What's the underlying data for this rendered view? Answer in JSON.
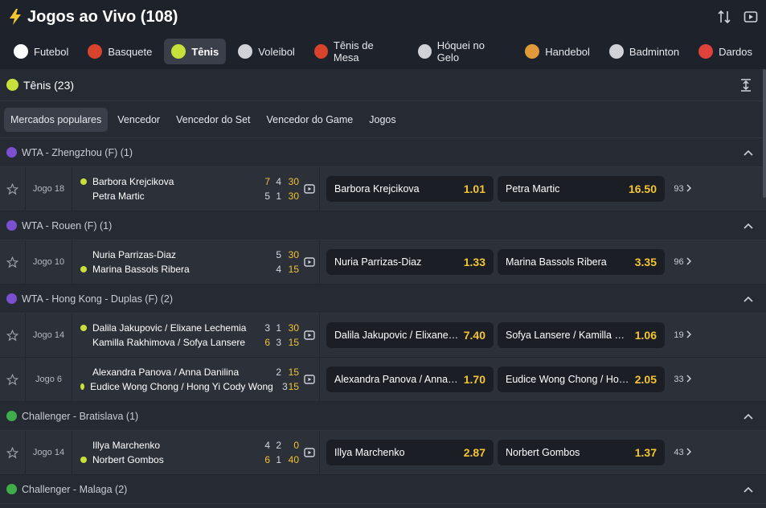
{
  "header": {
    "title": "Jogos ao Vivo (108)"
  },
  "sports": [
    {
      "label": "Futebol",
      "icon": "soccer-ball-icon",
      "color": "#ffffff"
    },
    {
      "label": "Basquete",
      "icon": "basketball-icon",
      "color": "#d8432e"
    },
    {
      "label": "Tênis",
      "icon": "tennis-ball-icon",
      "color": "#c8e03a",
      "active": true
    },
    {
      "label": "Voleibol",
      "icon": "volleyball-icon",
      "color": "#cfd2d8"
    },
    {
      "label": "Tênis de Mesa",
      "icon": "table-tennis-icon",
      "color": "#d8432e"
    },
    {
      "label": "Hóquei no Gelo",
      "icon": "hockey-stick-icon",
      "color": "#cfd2d8"
    },
    {
      "label": "Handebol",
      "icon": "handball-icon",
      "color": "#e09a3a"
    },
    {
      "label": "Badminton",
      "icon": "shuttlecock-icon",
      "color": "#cfd2d8"
    },
    {
      "label": "Dardos",
      "icon": "dart-icon",
      "color": "#e0413a"
    }
  ],
  "section": {
    "title": "Tênis (23)"
  },
  "tabs": [
    "Mercados populares",
    "Vencedor",
    "Vencedor do Set",
    "Vencedor do Game",
    "Jogos"
  ],
  "leagues": [
    {
      "name": "WTA - Zhengzhou (F) (1)",
      "badge": "WTA"
    },
    {
      "name": "WTA - Rouen (F) (1)",
      "badge": "WTA"
    },
    {
      "name": "WTA - Hong Kong - Duplas (F) (2)",
      "badge": "WTA"
    },
    {
      "name": "Challenger - Bratislava (1)",
      "badge": "CH"
    },
    {
      "name": "Challenger - Malaga (2)",
      "badge": "CH"
    }
  ],
  "matches": [
    {
      "jogo": "Jogo 18",
      "p1": {
        "name": "Barbora Krejcikova",
        "serve": true,
        "scores": [
          "7",
          "4"
        ],
        "points": "30"
      },
      "p2": {
        "name": "Petra Martic",
        "serve": false,
        "scores": [
          "5",
          "1"
        ],
        "points": "30"
      },
      "odd1": {
        "name": "Barbora Krejcikova",
        "value": "1.01"
      },
      "odd2": {
        "name": "Petra Martic",
        "value": "16.50"
      },
      "more": "93"
    },
    {
      "jogo": "Jogo 10",
      "p1": {
        "name": "Nuria Parrizas-Diaz",
        "serve": false,
        "scores": [
          "",
          "5"
        ],
        "points": "30"
      },
      "p2": {
        "name": "Marina Bassols Ribera",
        "serve": true,
        "scores": [
          "",
          "4"
        ],
        "points": "15"
      },
      "odd1": {
        "name": "Nuria Parrizas-Diaz",
        "value": "1.33"
      },
      "odd2": {
        "name": "Marina Bassols Ribera",
        "value": "3.35"
      },
      "more": "96"
    },
    {
      "jogo": "Jogo 14",
      "p1": {
        "name": "Dalila Jakupovic / Elixane Lechemia",
        "serve": true,
        "scores": [
          "3",
          "1"
        ],
        "points": "30"
      },
      "p2": {
        "name": "Kamilla Rakhimova / Sofya Lansere",
        "serve": false,
        "scores": [
          "6",
          "3"
        ],
        "points": "15"
      },
      "odd1": {
        "name": "Dalila Jakupovic / Elixane L...",
        "value": "7.40"
      },
      "odd2": {
        "name": "Sofya Lansere / Kamilla Ra...",
        "value": "1.06"
      },
      "more": "19"
    },
    {
      "jogo": "Jogo 6",
      "p1": {
        "name": "Alexandra Panova / Anna Danilina",
        "serve": false,
        "scores": [
          "",
          "2"
        ],
        "points": "15"
      },
      "p2": {
        "name": "Eudice Wong Chong / Hong Yi Cody Wong",
        "serve": true,
        "scores": [
          "",
          "3"
        ],
        "points": "15"
      },
      "odd1": {
        "name": "Alexandra Panova / Anna D...",
        "value": "1.70"
      },
      "odd2": {
        "name": "Eudice Wong Chong / Hong...",
        "value": "2.05"
      },
      "more": "33"
    },
    {
      "jogo": "Jogo 14",
      "p1": {
        "name": "Illya Marchenko",
        "serve": false,
        "scores": [
          "4",
          "2"
        ],
        "points": "0"
      },
      "p2": {
        "name": "Norbert Gombos",
        "serve": true,
        "scores": [
          "6",
          "1"
        ],
        "points": "40"
      },
      "odd1": {
        "name": "Illya Marchenko",
        "value": "2.87"
      },
      "odd2": {
        "name": "Norbert Gombos",
        "value": "1.37"
      },
      "more": "43"
    }
  ]
}
